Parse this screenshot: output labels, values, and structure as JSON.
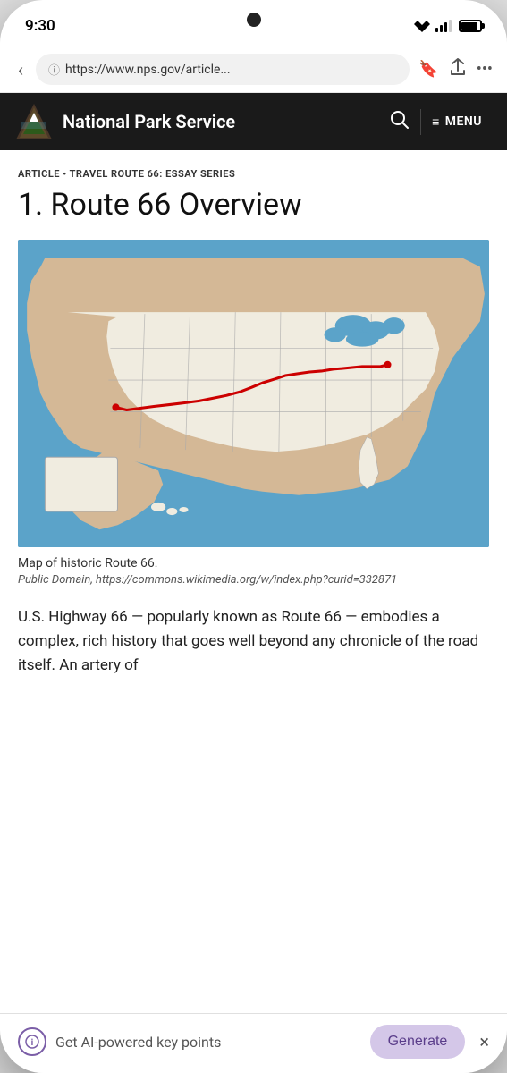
{
  "status": {
    "time": "9:30",
    "url": "https://www.nps.gov/articles",
    "url_display": "https://www.nps.gov/article..."
  },
  "header": {
    "site_name": "National Park Service",
    "menu_label": "MENU"
  },
  "article": {
    "category": "ARTICLE • TRAVEL ROUTE 66: ESSAY SERIES",
    "title": "1. Route 66 Overview",
    "map_caption": "Map of historic Route 66.",
    "map_attribution": "Public Domain, https://commons.wikimedia.org/w/index.php?curid=332871",
    "body_text": "U.S. Highway 66 — popularly known as Route 66 — embodies a complex, rich history that goes well beyond any chronicle of the road itself. An artery of"
  },
  "ai_bar": {
    "prompt_text": "Get AI-powered key points",
    "generate_label": "Generate",
    "close_label": "×"
  },
  "icons": {
    "back": "‹",
    "search": "⌕",
    "hamburger": "≡",
    "bookmark": "⊡",
    "share": "⎋",
    "more": "⋯",
    "info_circle": "ⓘ"
  }
}
